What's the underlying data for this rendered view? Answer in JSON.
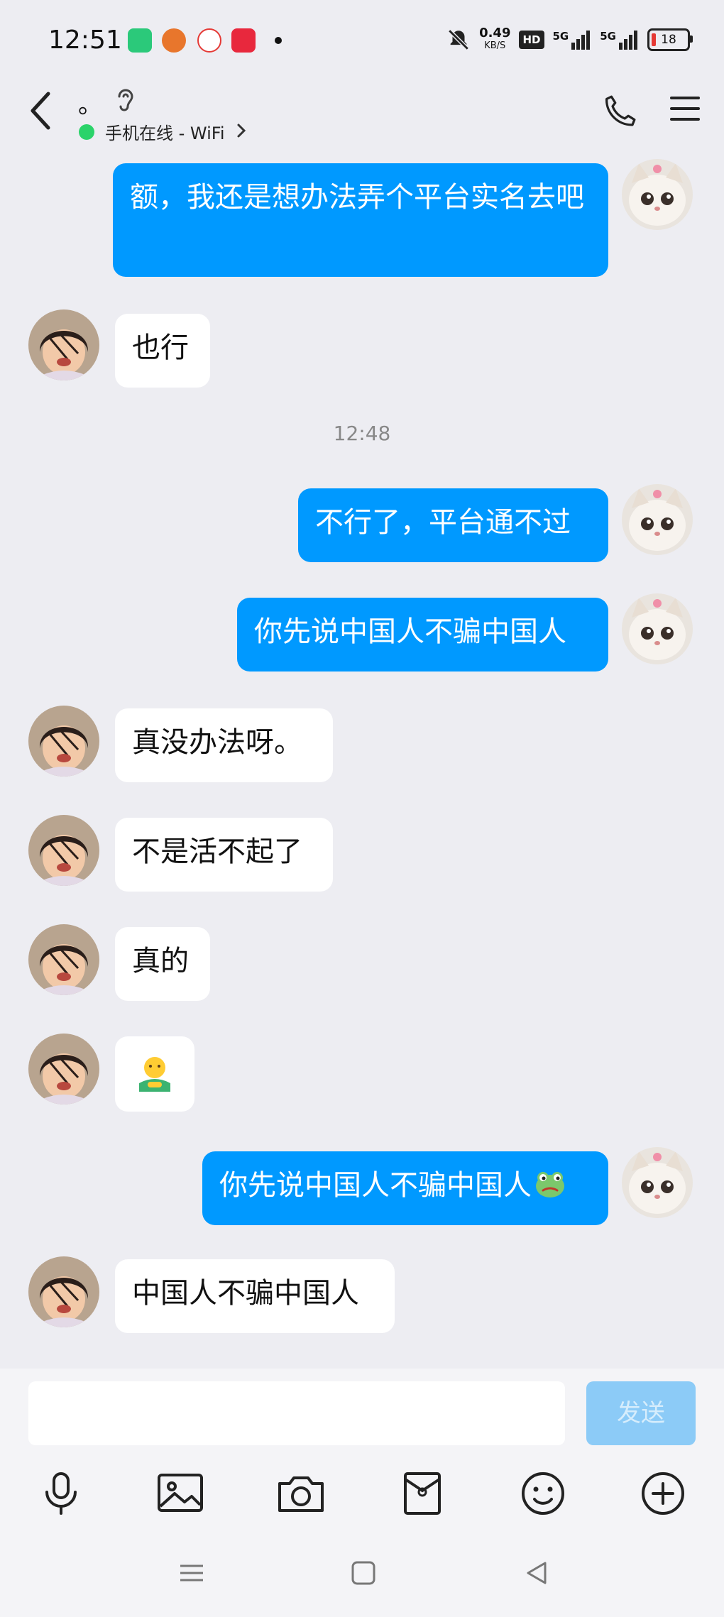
{
  "status": {
    "time": "12:51",
    "net_speed": "0.49",
    "net_unit": "KB/S",
    "hd": "HD",
    "sig1": "5G",
    "sig2": "5G",
    "battery": "18"
  },
  "header": {
    "title": "。",
    "subtitle": "手机在线 - WiFi"
  },
  "messages": [
    {
      "side": "out",
      "text": "额，我还是想办法弄个平台实名去吧"
    },
    {
      "side": "in",
      "text": "也行"
    },
    {
      "type": "time",
      "text": "12:48"
    },
    {
      "side": "out",
      "text": "不行了，平台通不过"
    },
    {
      "side": "out",
      "text": "你先说中国人不骗中国人"
    },
    {
      "side": "in",
      "text": "真没办法呀。"
    },
    {
      "side": "in",
      "text": "不是活不起了"
    },
    {
      "side": "in",
      "text": "真的"
    },
    {
      "side": "in",
      "emoji": "hug-emoji"
    },
    {
      "side": "out",
      "text": "你先说中国人不骗中国人",
      "emoji": "frog-emoji"
    },
    {
      "side": "in",
      "text": "中国人不骗中国人"
    }
  ],
  "input": {
    "value": "",
    "send_label": "发送"
  },
  "toolbar": [
    "microphone-icon",
    "image-icon",
    "camera-icon",
    "red-packet-icon",
    "emoji-icon",
    "plus-icon"
  ],
  "colors": {
    "outgoing_bubble": "#0099FF",
    "incoming_bubble": "#FFFFFF",
    "background": "#EDEDF2",
    "online": "#2BD36A"
  }
}
